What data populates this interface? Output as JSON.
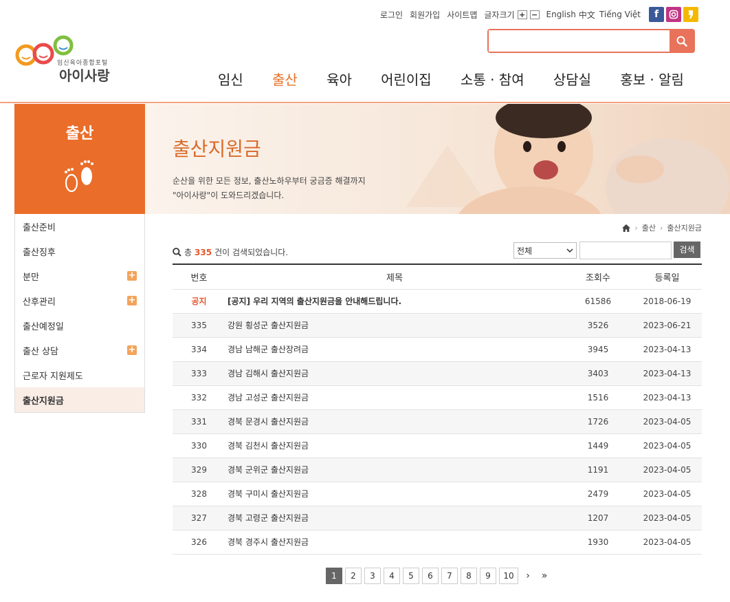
{
  "util": {
    "login": "로그인",
    "join": "회원가입",
    "sitemap": "사이트맵",
    "font_size": "글자크기",
    "plus": "+",
    "minus": "−",
    "english": "English",
    "chinese": "中文",
    "vietnamese": "Tiếng Việt"
  },
  "logo": {
    "sub": "임신육아종합포털",
    "main": "아이사랑"
  },
  "search": {
    "placeholder": ""
  },
  "gnb": [
    "임신",
    "출산",
    "육아",
    "어린이집",
    "소통 · 참여",
    "상담실",
    "홍보 · 알림"
  ],
  "section": {
    "title": "출산"
  },
  "banner": {
    "title": "출산지원금",
    "desc1": "순산을 위한 모든 정보, 출산노하우부터 궁금증 해결까지",
    "desc2": "\"아이사랑\"이 도와드리겠습니다."
  },
  "lnb": [
    {
      "label": "출산준비",
      "plus": false
    },
    {
      "label": "출산징후",
      "plus": false
    },
    {
      "label": "분만",
      "plus": true
    },
    {
      "label": "산후관리",
      "plus": true
    },
    {
      "label": "출산예정일",
      "plus": false
    },
    {
      "label": "출산 상담",
      "plus": true
    },
    {
      "label": "근로자 지원제도",
      "plus": false
    },
    {
      "label": "출산지원금",
      "plus": false,
      "active": true
    }
  ],
  "breadcrumb": [
    "출산",
    "출산지원금"
  ],
  "count": {
    "prefix": "총",
    "num": "335",
    "suffix": "건이 검색되었습니다."
  },
  "filter": {
    "select": "전체",
    "button": "검색"
  },
  "table": {
    "headers": [
      "번호",
      "제목",
      "조회수",
      "등록일"
    ],
    "rows": [
      {
        "no": "공지",
        "title": "[공지] 우리 지역의 출산지원금을 안내해드립니다.",
        "views": "61586",
        "date": "2018-06-19",
        "notice": true
      },
      {
        "no": "335",
        "title": "강원 횡성군 출산지원금",
        "views": "3526",
        "date": "2023-06-21"
      },
      {
        "no": "334",
        "title": "경남 남해군 출산장려금",
        "views": "3945",
        "date": "2023-04-13"
      },
      {
        "no": "333",
        "title": "경남 김해시 출산지원금",
        "views": "3403",
        "date": "2023-04-13"
      },
      {
        "no": "332",
        "title": "경남 고성군 출산지원금",
        "views": "1516",
        "date": "2023-04-13"
      },
      {
        "no": "331",
        "title": "경북 문경시 출산지원금",
        "views": "1726",
        "date": "2023-04-05"
      },
      {
        "no": "330",
        "title": "경북 김천시 출산지원금",
        "views": "1449",
        "date": "2023-04-05"
      },
      {
        "no": "329",
        "title": "경북 군위군 출산지원금",
        "views": "1191",
        "date": "2023-04-05"
      },
      {
        "no": "328",
        "title": "경북 구미시 출산지원금",
        "views": "2479",
        "date": "2023-04-05"
      },
      {
        "no": "327",
        "title": "경북 고령군 출산지원금",
        "views": "1207",
        "date": "2023-04-05"
      },
      {
        "no": "326",
        "title": "경북 경주시 출산지원금",
        "views": "1930",
        "date": "2023-04-05"
      }
    ]
  },
  "pager": {
    "pages": [
      "1",
      "2",
      "3",
      "4",
      "5",
      "6",
      "7",
      "8",
      "9",
      "10"
    ],
    "current": "1",
    "next": "›",
    "last": "»"
  },
  "colors": {
    "accent": "#ea6d2a",
    "search": "#e8725a"
  }
}
